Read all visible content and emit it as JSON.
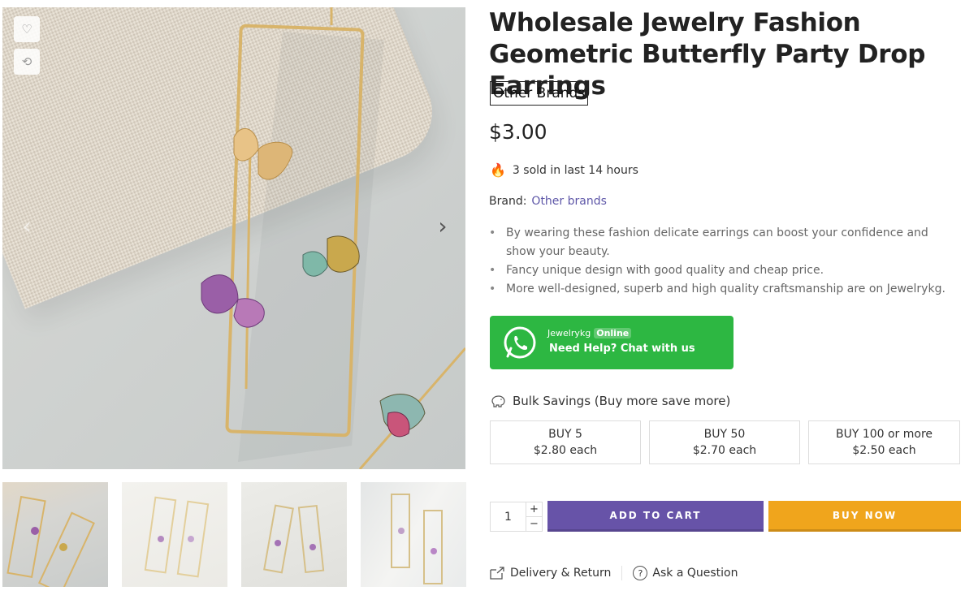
{
  "product": {
    "title": "Wholesale Jewelry Fashion Geometric Butterfly Party Drop Earrings",
    "brand_badge": "Other Brands",
    "price": "$3.00",
    "sold_text": "3 sold in last 14 hours",
    "brand_label": "Brand:",
    "brand_value": "Other brands",
    "bullets": [
      "By wearing these fashion delicate earrings can boost your confidence and show your beauty.",
      "Fancy unique design with good quality and cheap price.",
      "More well-designed, superb and high quality craftsmanship are on Jewelrykg."
    ]
  },
  "whatsapp": {
    "name": "Jewelrykg",
    "status": "Online",
    "cta": "Need Help? Chat with us",
    "color": "#2db742"
  },
  "bulk": {
    "title": "Bulk Savings (Buy more save more)",
    "tiers": [
      {
        "label": "BUY 5",
        "price": "$2.80 each"
      },
      {
        "label": "BUY 50",
        "price": "$2.70 each"
      },
      {
        "label": "BUY 100 or more",
        "price": "$2.50 each"
      }
    ]
  },
  "cart": {
    "quantity": "1",
    "plus": "+",
    "minus": "−",
    "add_to_cart": "ADD TO CART",
    "buy_now": "BUY NOW",
    "add_color": "#6753a8",
    "buy_color": "#f0a51c"
  },
  "links": {
    "delivery": "Delivery & Return",
    "ask": "Ask a Question"
  },
  "gallery": {
    "thumbnail_count": 4,
    "icons": [
      "heart-icon",
      "compare-icon",
      "chevron-left-icon",
      "chevron-right-icon"
    ]
  }
}
